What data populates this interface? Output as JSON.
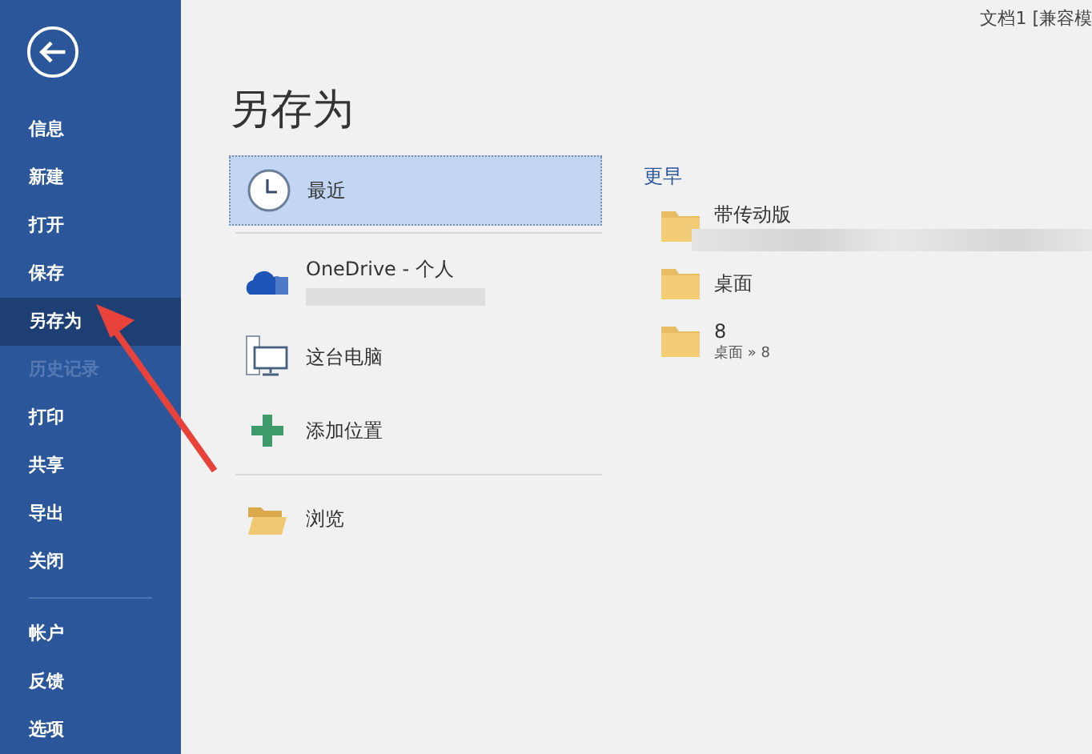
{
  "window": {
    "title": "文档1 [兼容模"
  },
  "sidebar": {
    "items": [
      {
        "label": "信息",
        "selected": false,
        "disabled": false
      },
      {
        "label": "新建",
        "selected": false,
        "disabled": false
      },
      {
        "label": "打开",
        "selected": false,
        "disabled": false
      },
      {
        "label": "保存",
        "selected": false,
        "disabled": false
      },
      {
        "label": "另存为",
        "selected": true,
        "disabled": false
      },
      {
        "label": "历史记录",
        "selected": false,
        "disabled": true
      },
      {
        "label": "打印",
        "selected": false,
        "disabled": false
      },
      {
        "label": "共享",
        "selected": false,
        "disabled": false
      },
      {
        "label": "导出",
        "selected": false,
        "disabled": false
      },
      {
        "label": "关闭",
        "selected": false,
        "disabled": false
      }
    ],
    "bottom_items": [
      {
        "label": "帐户",
        "selected": false,
        "disabled": false
      },
      {
        "label": "反馈",
        "selected": false,
        "disabled": false
      },
      {
        "label": "选项",
        "selected": false,
        "disabled": false
      }
    ]
  },
  "page_title": "另存为",
  "locations": [
    {
      "kind": "recent",
      "label": "最近",
      "selected": true
    },
    {
      "kind": "onedrive",
      "label": "OneDrive - 个人",
      "selected": false
    },
    {
      "kind": "pc",
      "label": "这台电脑",
      "selected": false
    },
    {
      "kind": "add",
      "label": "添加位置",
      "selected": false
    },
    {
      "kind": "browse",
      "label": "浏览",
      "selected": false
    }
  ],
  "recent_folders": {
    "heading": "更早",
    "folders": [
      {
        "name": "带传动版",
        "blurred": true
      },
      {
        "name": "桌面",
        "blurred": false
      },
      {
        "name": "8",
        "path": "桌面 » 8",
        "blurred": false
      }
    ]
  }
}
